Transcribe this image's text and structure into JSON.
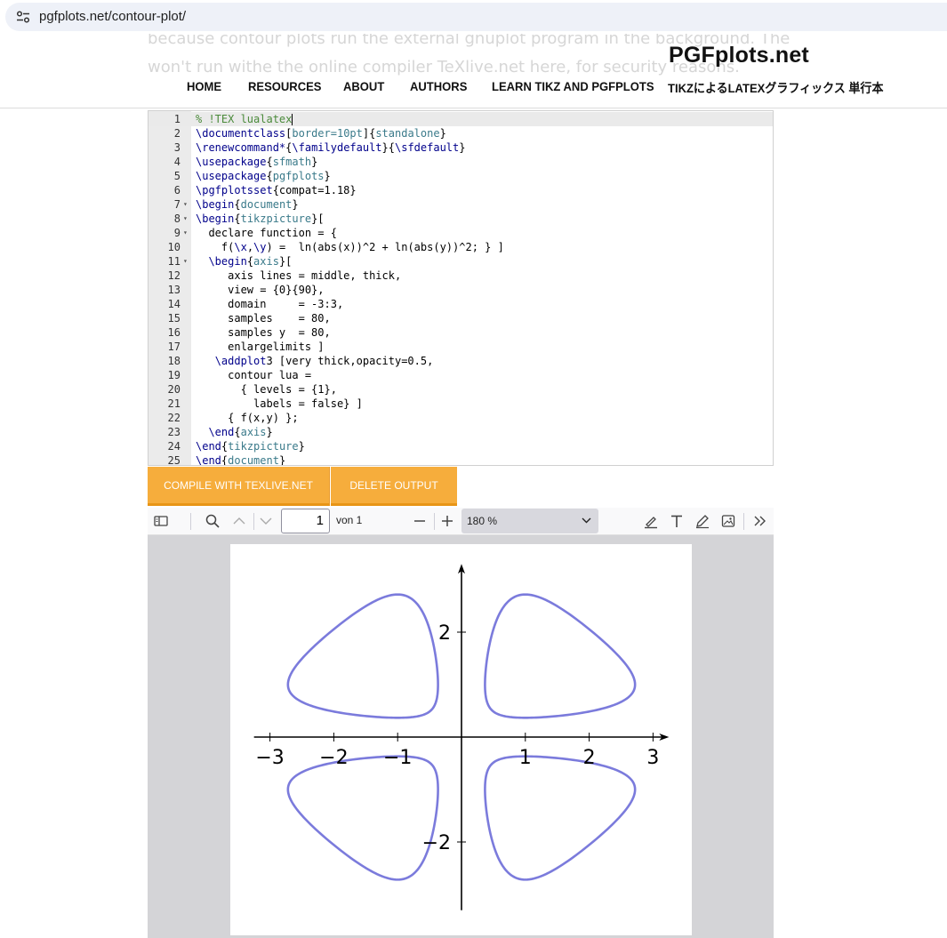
{
  "browser": {
    "url": "pgfplots.net/contour-plot/"
  },
  "site": {
    "title": "PGFplots.net",
    "ghost_line_1": "because contour plots run the external gnuplot program in the background. The",
    "ghost_line_2": "won't run withe the online compiler TeXlive.net here, for security reasons.",
    "nav": [
      "HOME",
      "RESOURCES",
      "ABOUT",
      "AUTHORS",
      "LEARN TIKZ AND PGFPLOTS",
      "TIKZによるLATEXグラフィックス 単行本"
    ]
  },
  "editor": {
    "lines": [
      "% !TEX lualatex",
      "\\documentclass[border=10pt]{standalone}",
      "\\renewcommand*{\\familydefault}{\\sfdefault}",
      "\\usepackage{sfmath}",
      "\\usepackage{pgfplots}",
      "\\pgfplotsset{compat=1.18}",
      "\\begin{document}",
      "\\begin{tikzpicture}[",
      "  declare function = {",
      "    f(\\x,\\y) =  ln(abs(x))^2 + ln(abs(y))^2; } ]",
      "  \\begin{axis}[",
      "     axis lines = middle, thick,",
      "     view = {0}{90},",
      "     domain     = -3:3,",
      "     samples    = 80,",
      "     samples y  = 80,",
      "     enlargelimits ]",
      "   \\addplot3 [very thick,opacity=0.5,",
      "     contour lua =",
      "       { levels = {1},",
      "         labels = false} ]",
      "     { f(x,y) };",
      "  \\end{axis}",
      "\\end{tikzpicture}",
      "\\end{document}"
    ]
  },
  "buttons": {
    "compile": "COMPILE WITH TEXLIVE.NET",
    "delete": "DELETE OUTPUT"
  },
  "pdf_viewer": {
    "page_number": "1",
    "page_of": "von 1",
    "zoom": "180 %"
  },
  "chart_data": {
    "type": "contour",
    "function": "ln(abs(x))^2 + ln(abs(y))^2",
    "level": 1,
    "xlim": [
      -3,
      3
    ],
    "ylim": [
      -3,
      3
    ],
    "x_ticks": [
      -3,
      -2,
      -1,
      1,
      2,
      3
    ],
    "x_tick_labels": [
      "−3",
      "−2",
      "−1",
      "1",
      "2",
      "3"
    ],
    "y_ticks": [
      -2,
      2
    ],
    "y_tick_labels": [
      "−2",
      "2"
    ],
    "line_color": "#7b7bdc"
  }
}
